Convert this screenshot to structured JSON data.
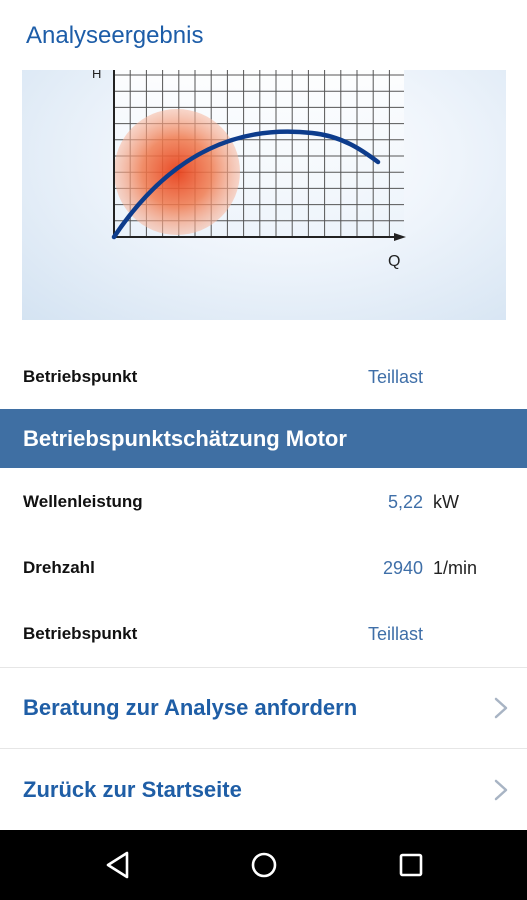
{
  "header": {
    "title": "Analyseergebnis"
  },
  "chart": {
    "y_axis_label": "H",
    "x_axis_label": "Q",
    "colors": {
      "curve": "#0d3c8c",
      "hotspot": "#e8552a",
      "grid": "#4b4b4b"
    }
  },
  "summary": {
    "label": "Betriebspunkt",
    "value": "Teillast"
  },
  "section": {
    "title": "Betriebspunktschätzung Motor"
  },
  "details": [
    {
      "label": "Wellenleistung",
      "value": "5,22",
      "unit": "kW"
    },
    {
      "label": "Drehzahl",
      "value": "2940",
      "unit": "1/min"
    },
    {
      "label": "Betriebspunkt",
      "value": "Teillast",
      "unit": ""
    }
  ],
  "links": [
    {
      "label": "Beratung zur Analyse anfordern",
      "icon": "chevron-right-icon"
    },
    {
      "label": "Zurück zur Startseite",
      "icon": "chevron-right-icon"
    }
  ],
  "navbar": {
    "back_icon": "back-triangle-icon",
    "home_icon": "home-circle-icon",
    "recents_icon": "recents-square-icon"
  }
}
